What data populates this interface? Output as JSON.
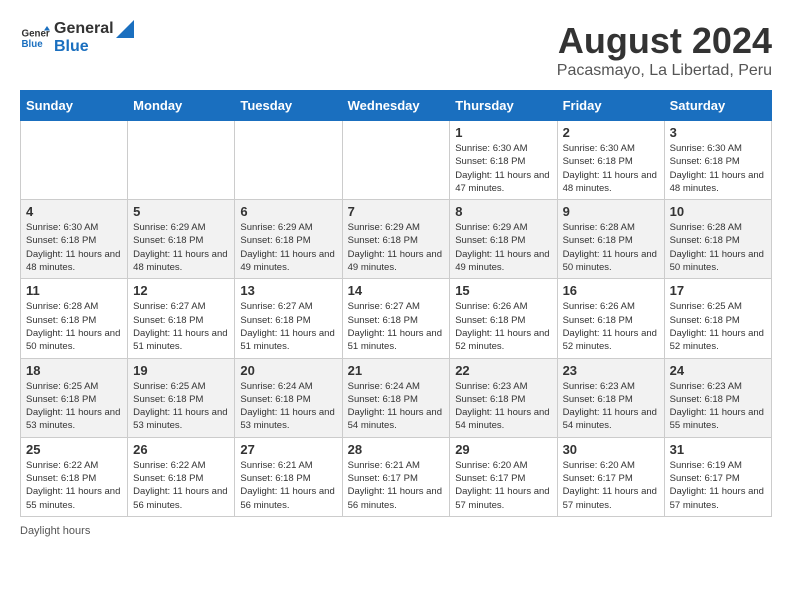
{
  "header": {
    "logo_general": "General",
    "logo_blue": "Blue",
    "title": "August 2024",
    "subtitle": "Pacasmayo, La Libertad, Peru"
  },
  "days_of_week": [
    "Sunday",
    "Monday",
    "Tuesday",
    "Wednesday",
    "Thursday",
    "Friday",
    "Saturday"
  ],
  "weeks": [
    [
      {
        "day": "",
        "info": ""
      },
      {
        "day": "",
        "info": ""
      },
      {
        "day": "",
        "info": ""
      },
      {
        "day": "",
        "info": ""
      },
      {
        "day": "1",
        "info": "Sunrise: 6:30 AM\nSunset: 6:18 PM\nDaylight: 11 hours and 47 minutes."
      },
      {
        "day": "2",
        "info": "Sunrise: 6:30 AM\nSunset: 6:18 PM\nDaylight: 11 hours and 48 minutes."
      },
      {
        "day": "3",
        "info": "Sunrise: 6:30 AM\nSunset: 6:18 PM\nDaylight: 11 hours and 48 minutes."
      }
    ],
    [
      {
        "day": "4",
        "info": "Sunrise: 6:30 AM\nSunset: 6:18 PM\nDaylight: 11 hours and 48 minutes."
      },
      {
        "day": "5",
        "info": "Sunrise: 6:29 AM\nSunset: 6:18 PM\nDaylight: 11 hours and 48 minutes."
      },
      {
        "day": "6",
        "info": "Sunrise: 6:29 AM\nSunset: 6:18 PM\nDaylight: 11 hours and 49 minutes."
      },
      {
        "day": "7",
        "info": "Sunrise: 6:29 AM\nSunset: 6:18 PM\nDaylight: 11 hours and 49 minutes."
      },
      {
        "day": "8",
        "info": "Sunrise: 6:29 AM\nSunset: 6:18 PM\nDaylight: 11 hours and 49 minutes."
      },
      {
        "day": "9",
        "info": "Sunrise: 6:28 AM\nSunset: 6:18 PM\nDaylight: 11 hours and 50 minutes."
      },
      {
        "day": "10",
        "info": "Sunrise: 6:28 AM\nSunset: 6:18 PM\nDaylight: 11 hours and 50 minutes."
      }
    ],
    [
      {
        "day": "11",
        "info": "Sunrise: 6:28 AM\nSunset: 6:18 PM\nDaylight: 11 hours and 50 minutes."
      },
      {
        "day": "12",
        "info": "Sunrise: 6:27 AM\nSunset: 6:18 PM\nDaylight: 11 hours and 51 minutes."
      },
      {
        "day": "13",
        "info": "Sunrise: 6:27 AM\nSunset: 6:18 PM\nDaylight: 11 hours and 51 minutes."
      },
      {
        "day": "14",
        "info": "Sunrise: 6:27 AM\nSunset: 6:18 PM\nDaylight: 11 hours and 51 minutes."
      },
      {
        "day": "15",
        "info": "Sunrise: 6:26 AM\nSunset: 6:18 PM\nDaylight: 11 hours and 52 minutes."
      },
      {
        "day": "16",
        "info": "Sunrise: 6:26 AM\nSunset: 6:18 PM\nDaylight: 11 hours and 52 minutes."
      },
      {
        "day": "17",
        "info": "Sunrise: 6:25 AM\nSunset: 6:18 PM\nDaylight: 11 hours and 52 minutes."
      }
    ],
    [
      {
        "day": "18",
        "info": "Sunrise: 6:25 AM\nSunset: 6:18 PM\nDaylight: 11 hours and 53 minutes."
      },
      {
        "day": "19",
        "info": "Sunrise: 6:25 AM\nSunset: 6:18 PM\nDaylight: 11 hours and 53 minutes."
      },
      {
        "day": "20",
        "info": "Sunrise: 6:24 AM\nSunset: 6:18 PM\nDaylight: 11 hours and 53 minutes."
      },
      {
        "day": "21",
        "info": "Sunrise: 6:24 AM\nSunset: 6:18 PM\nDaylight: 11 hours and 54 minutes."
      },
      {
        "day": "22",
        "info": "Sunrise: 6:23 AM\nSunset: 6:18 PM\nDaylight: 11 hours and 54 minutes."
      },
      {
        "day": "23",
        "info": "Sunrise: 6:23 AM\nSunset: 6:18 PM\nDaylight: 11 hours and 54 minutes."
      },
      {
        "day": "24",
        "info": "Sunrise: 6:23 AM\nSunset: 6:18 PM\nDaylight: 11 hours and 55 minutes."
      }
    ],
    [
      {
        "day": "25",
        "info": "Sunrise: 6:22 AM\nSunset: 6:18 PM\nDaylight: 11 hours and 55 minutes."
      },
      {
        "day": "26",
        "info": "Sunrise: 6:22 AM\nSunset: 6:18 PM\nDaylight: 11 hours and 56 minutes."
      },
      {
        "day": "27",
        "info": "Sunrise: 6:21 AM\nSunset: 6:18 PM\nDaylight: 11 hours and 56 minutes."
      },
      {
        "day": "28",
        "info": "Sunrise: 6:21 AM\nSunset: 6:17 PM\nDaylight: 11 hours and 56 minutes."
      },
      {
        "day": "29",
        "info": "Sunrise: 6:20 AM\nSunset: 6:17 PM\nDaylight: 11 hours and 57 minutes."
      },
      {
        "day": "30",
        "info": "Sunrise: 6:20 AM\nSunset: 6:17 PM\nDaylight: 11 hours and 57 minutes."
      },
      {
        "day": "31",
        "info": "Sunrise: 6:19 AM\nSunset: 6:17 PM\nDaylight: 11 hours and 57 minutes."
      }
    ]
  ],
  "footer": {
    "note": "Daylight hours"
  }
}
